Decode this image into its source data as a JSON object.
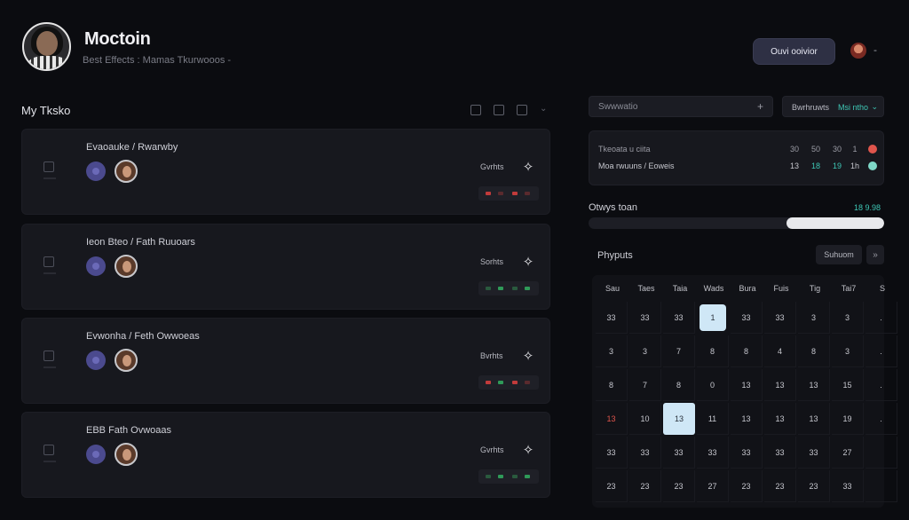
{
  "header": {
    "title": "Moctoin",
    "subtitle": "Best Effects : Mamas   Tkurwooos -",
    "primary_button": "Ouvi ooivior",
    "user_menu_chevron": "-"
  },
  "tasks_section": {
    "title": "My Tksko",
    "tasks": [
      {
        "title": "Evaoauke / Rwarwby",
        "meta": "Gvrhts"
      },
      {
        "title": "Ieon Bteo / Fath Ruuoars",
        "meta": "Sorhts"
      },
      {
        "title": "Evwonha / Feth Owwoeas",
        "meta": "Bvrhts"
      },
      {
        "title": "EBB Fath Ovwoaas",
        "meta": "Gvrhts"
      }
    ]
  },
  "right_panel": {
    "search_placeholder": "Swwwatio",
    "filter_label": "Bwrhruwts",
    "filter_value": "Msi ntho",
    "stats": [
      {
        "name": "Tkeoata u ciita",
        "values": [
          "30",
          "50",
          "30",
          "1"
        ],
        "dot_color": "#e0554c"
      },
      {
        "name": "Moa rwuuns / Eoweis",
        "values": [
          "13",
          "18",
          "19",
          "1h"
        ],
        "dot_color": "#7fd8c8"
      }
    ],
    "progress_label": "Otwys toan",
    "progress_value": "18 9.98",
    "progress_fraction": 0.33
  },
  "calendar": {
    "title": "Phyputs",
    "month_button": "Suhuom",
    "nav_button": "»",
    "weekdays": [
      "Sau",
      "Taes",
      "Taia",
      "Wads",
      "Bura",
      "Fuis",
      "Tig",
      "Tai7",
      "S"
    ],
    "rows": [
      [
        "33",
        "33",
        "33",
        "1",
        "33",
        "33",
        "3",
        "3",
        "."
      ],
      [
        "3",
        "3",
        "7",
        "8",
        "8",
        "4",
        "8",
        "3",
        "."
      ],
      [
        "8",
        "7",
        "8",
        "0",
        "13",
        "13",
        "13",
        "15",
        "."
      ],
      [
        "13",
        "10",
        "13",
        "11",
        "13",
        "13",
        "13",
        "19",
        "."
      ],
      [
        "33",
        "33",
        "33",
        "33",
        "33",
        "33",
        "33",
        "27",
        ""
      ],
      [
        "23",
        "23",
        "23",
        "27",
        "23",
        "23",
        "23",
        "33",
        ""
      ]
    ],
    "selected_label": "13"
  }
}
